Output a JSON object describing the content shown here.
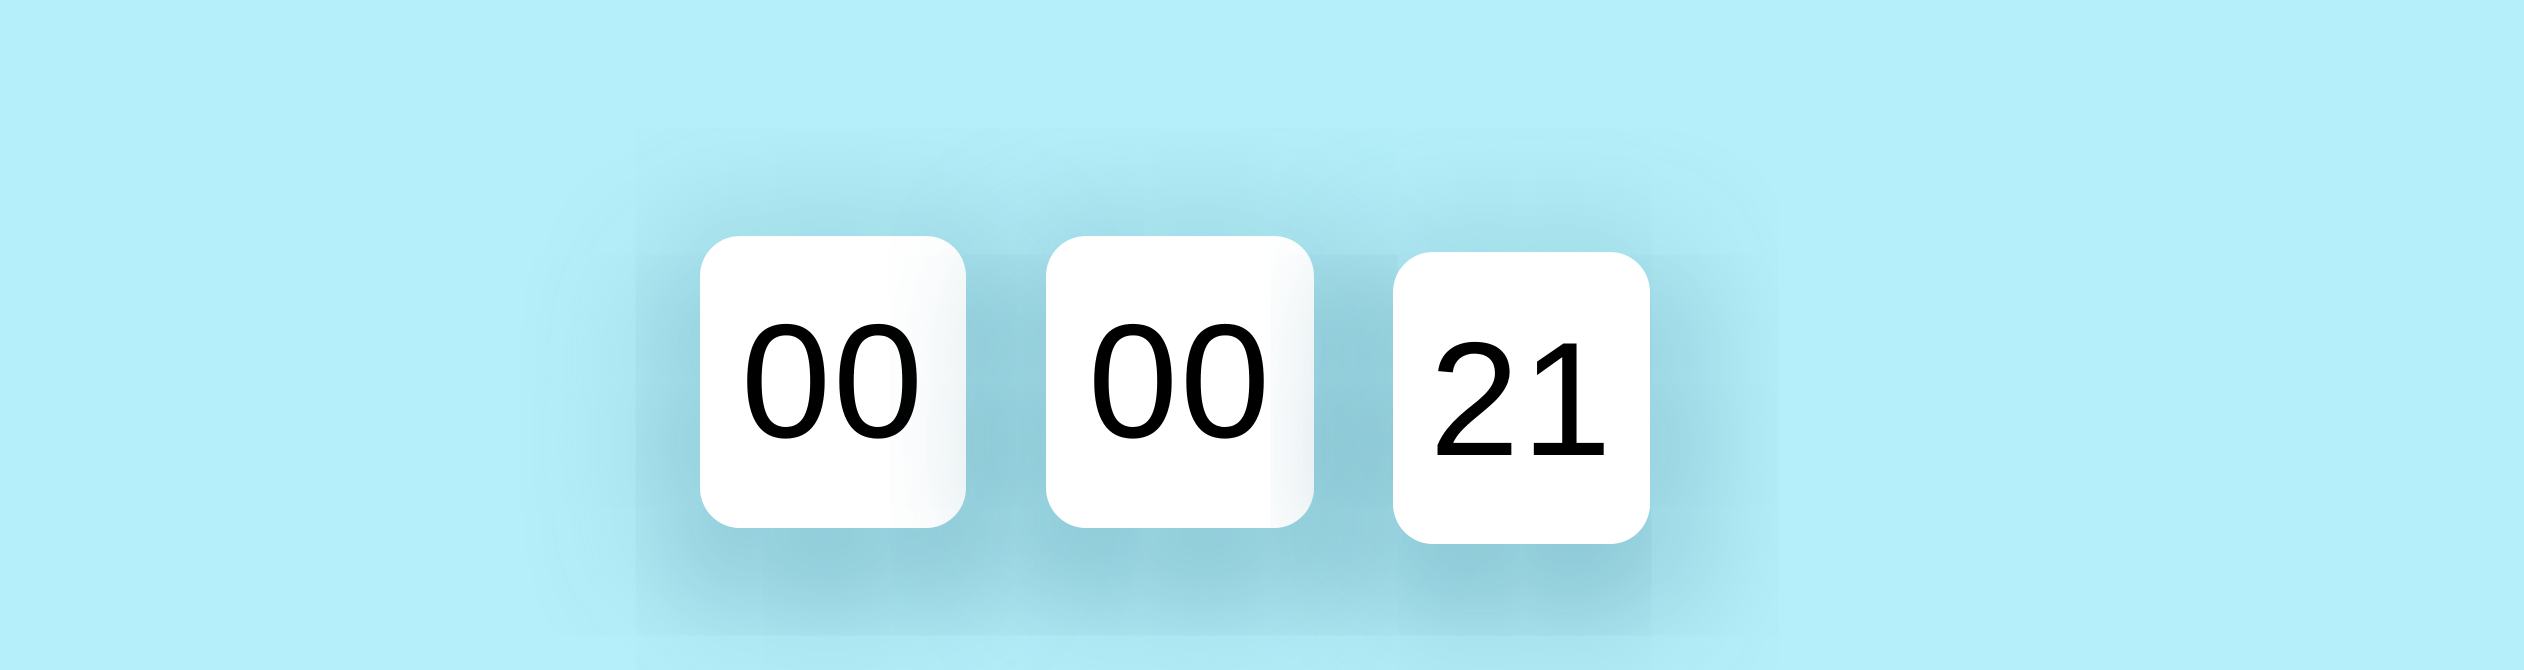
{
  "timer": {
    "hours": "00",
    "minutes": "00",
    "seconds": "21"
  }
}
